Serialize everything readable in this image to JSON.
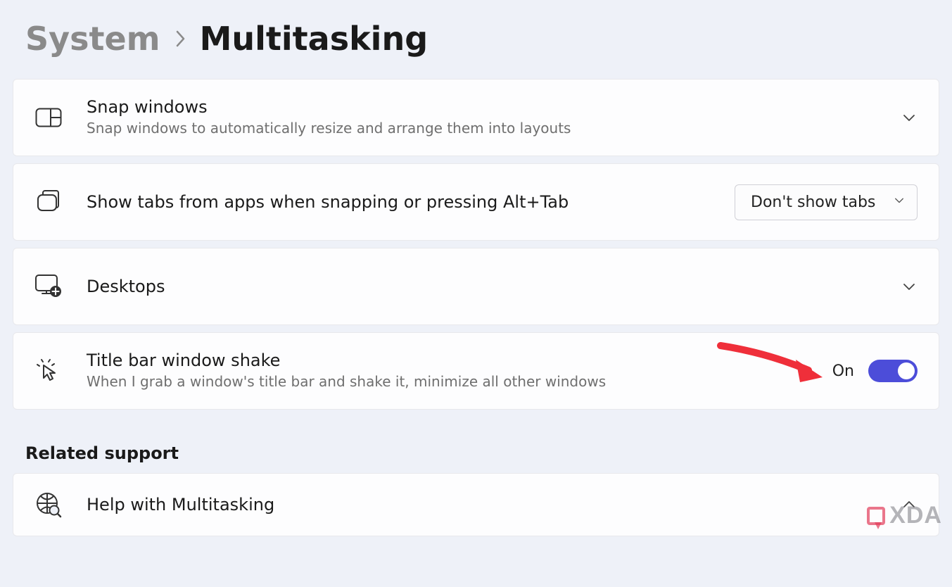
{
  "breadcrumb": {
    "parent": "System",
    "current": "Multitasking"
  },
  "cards": {
    "snap": {
      "title": "Snap windows",
      "desc": "Snap windows to automatically resize and arrange them into layouts"
    },
    "tabs": {
      "title": "Show tabs from apps when snapping or pressing Alt+Tab",
      "dropdown_value": "Don't show tabs"
    },
    "desktops": {
      "title": "Desktops"
    },
    "shake": {
      "title": "Title bar window shake",
      "desc": "When I grab a window's title bar and shake it, minimize all other windows",
      "toggle_label": "On",
      "toggle_on": true
    }
  },
  "related": {
    "heading": "Related support",
    "help_title": "Help with Multitasking"
  },
  "watermark": "XDA"
}
